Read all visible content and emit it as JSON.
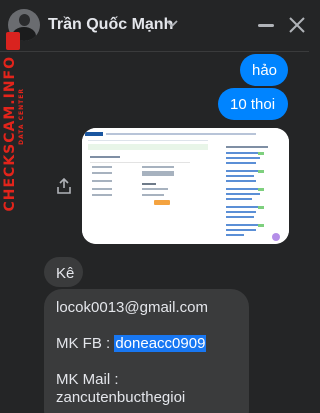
{
  "header": {
    "contact_name": "Trần Quốc Mạnh"
  },
  "watermark": {
    "brand": "CHECKSCAM.INFO",
    "subtitle": "DATA CENTER"
  },
  "messages": {
    "out_1": "hảo",
    "out_2": "10 thoi",
    "in_reply": "Kê",
    "long_line_1": "locok0013@gmail.com",
    "long_line_2_prefix": "MK FB : ",
    "long_line_2_highlight": "doneacc0909",
    "long_line_3": "MK Mail :",
    "long_line_4": "zancutenbucthegioi"
  },
  "colors": {
    "bubble_outgoing": "#0084ff",
    "bubble_incoming": "#3a3b3c",
    "background": "#242526",
    "watermark_red": "#e3241b",
    "selection_highlight": "#1877f2"
  }
}
